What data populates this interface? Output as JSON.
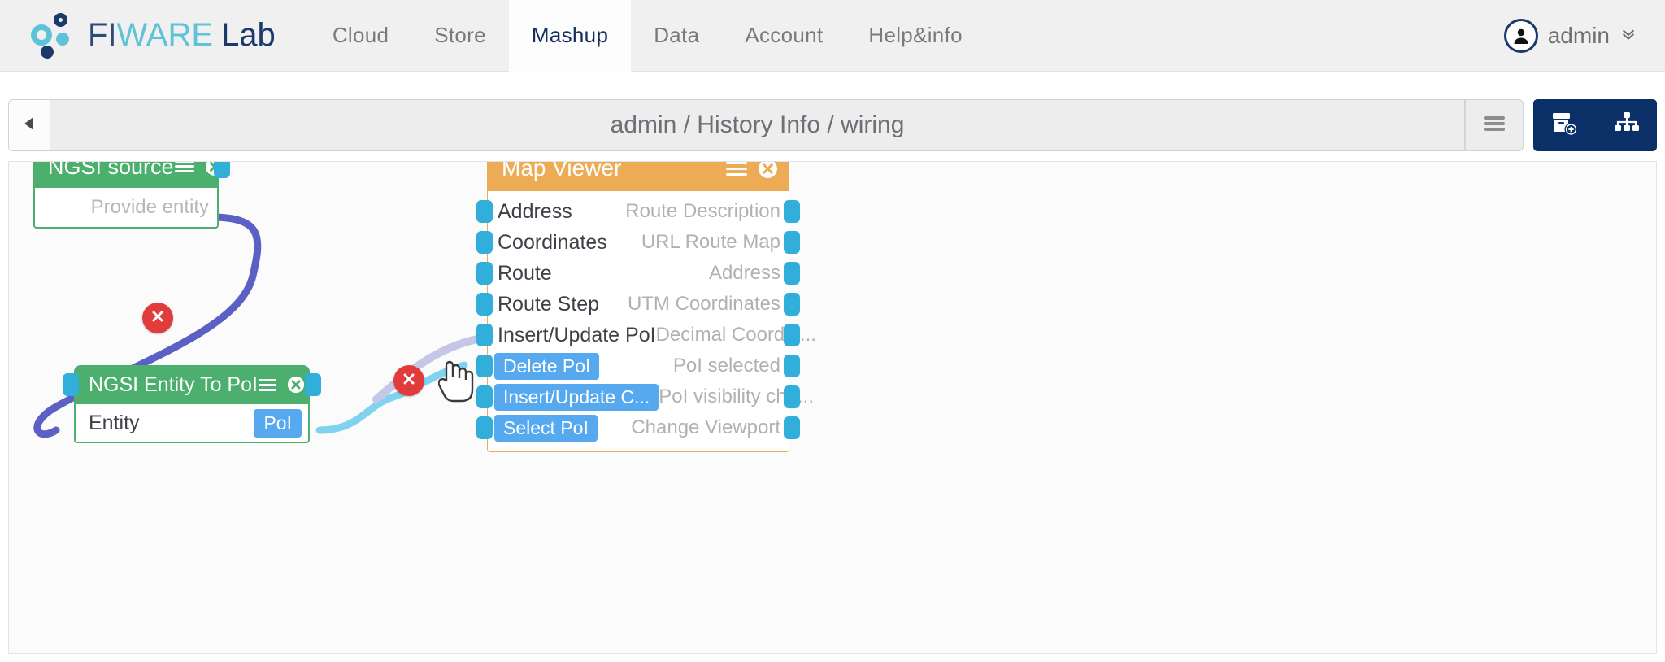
{
  "navbar": {
    "brand": {
      "fi": "FI",
      "ware": "WARE",
      "lab": "Lab",
      "logo_icon": "fiware-dots-logo"
    },
    "items": [
      {
        "label": "Cloud",
        "active": false
      },
      {
        "label": "Store",
        "active": false
      },
      {
        "label": "Mashup",
        "active": true
      },
      {
        "label": "Data",
        "active": false
      },
      {
        "label": "Account",
        "active": false
      },
      {
        "label": "Help&info",
        "active": false
      }
    ],
    "user": {
      "name": "admin",
      "avatar_icon": "user-avatar-icon",
      "caret_icon": "chevron-down-icon"
    }
  },
  "toolbar": {
    "back_icon": "back-triangle-icon",
    "title": "admin / History Info / wiring",
    "menu_icon": "hamburger-menu-icon",
    "actions": [
      {
        "icon": "add-component-icon",
        "name": "add-component-button"
      },
      {
        "icon": "behaviour-sitemap-icon",
        "name": "behaviour-view-button"
      }
    ]
  },
  "colors": {
    "brand_navy": "#1b3a6b",
    "brand_cyan": "#5ec3d8",
    "toolbar_navy": "#0b3068",
    "operator_green": "#4caf6d",
    "widget_orange": "#eeab56",
    "connector_blue": "#32aedb",
    "button_blue": "#57a9ef",
    "delete_red": "#e23b3b",
    "wire_purple": "#5c5fc4",
    "wire_light_blue": "#7fd2f0",
    "wire_lavender": "#c6c7e8"
  },
  "canvas": {
    "nodes": [
      {
        "id": "ngsi-source",
        "title": "NGSI source",
        "type": "operator",
        "menu_icon": "hamburger-menu-icon",
        "close_icon": "close-circle-icon",
        "outputs": [
          {
            "label": "Provide entity"
          }
        ]
      },
      {
        "id": "ngsi-entity-to-poi",
        "title": "NGSI Entity To PoI",
        "type": "operator",
        "menu_icon": "hamburger-menu-icon",
        "close_icon": "close-circle-icon",
        "inputs": [
          {
            "label": "Entity"
          }
        ],
        "outputs": [
          {
            "label": "PoI"
          }
        ]
      },
      {
        "id": "map-viewer",
        "title": "Map Viewer",
        "type": "widget",
        "menu_icon": "hamburger-menu-icon",
        "close_icon": "close-circle-icon",
        "endpoints": [
          {
            "in": "Address",
            "in_kind": "text",
            "out": "Route Description"
          },
          {
            "in": "Coordinates",
            "in_kind": "text",
            "out": "URL Route Map"
          },
          {
            "in": "Route",
            "in_kind": "text",
            "out": "Address"
          },
          {
            "in": "Route Step",
            "in_kind": "text",
            "out": "UTM Coordinates"
          },
          {
            "in": "Insert/Update PoI",
            "in_kind": "text",
            "out": "Decimal Coordin..."
          },
          {
            "in": "Delete PoI",
            "in_kind": "button",
            "out": "PoI selected"
          },
          {
            "in": "Insert/Update C...",
            "in_kind": "button",
            "out": "PoI visibility cha..."
          },
          {
            "in": "Select PoI",
            "in_kind": "button",
            "out": "Change Viewport"
          }
        ]
      }
    ],
    "wire_delete_markers": [
      {
        "name": "wire-delete-marker-1",
        "icon": "close-icon"
      },
      {
        "name": "wire-delete-marker-2",
        "icon": "close-icon"
      }
    ],
    "cursor_icon": "pointing-hand-cursor"
  }
}
